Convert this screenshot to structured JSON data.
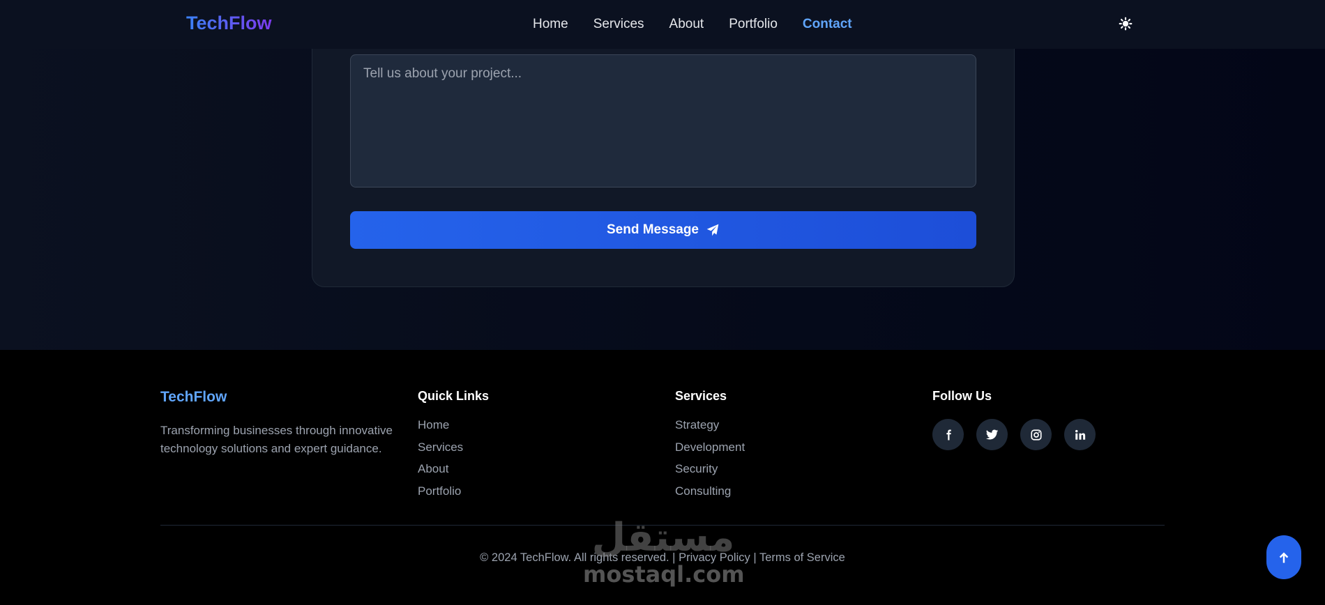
{
  "header": {
    "logo": "TechFlow",
    "nav": [
      {
        "label": "Home",
        "active": false
      },
      {
        "label": "Services",
        "active": false
      },
      {
        "label": "About",
        "active": false
      },
      {
        "label": "Portfolio",
        "active": false
      },
      {
        "label": "Contact",
        "active": true
      }
    ],
    "theme_icon": "sun-icon"
  },
  "form": {
    "message_placeholder": "Tell us about your project...",
    "message_value": "",
    "send_label": "Send Message",
    "send_icon": "paper-plane-icon"
  },
  "footer": {
    "brand": "TechFlow",
    "description": "Transforming businesses through innovative technology solutions and expert guidance.",
    "quick_links": {
      "title": "Quick Links",
      "items": [
        "Home",
        "Services",
        "About",
        "Portfolio"
      ]
    },
    "services": {
      "title": "Services",
      "items": [
        "Strategy",
        "Development",
        "Security",
        "Consulting"
      ]
    },
    "follow": {
      "title": "Follow Us",
      "icons": [
        "facebook-icon",
        "twitter-icon",
        "instagram-icon",
        "linkedin-icon"
      ]
    },
    "copyright": "© 2024 TechFlow. All rights reserved.",
    "separator": "|",
    "privacy": "Privacy Policy",
    "terms": "Terms of Service"
  },
  "watermark": {
    "arabic": "مستقل",
    "latin": "mostaql.com"
  },
  "scroll_top_icon": "arrow-up-icon",
  "colors": {
    "accent": "#2563eb",
    "link_active": "#60a5fa",
    "footer_bg": "#000000",
    "card_bg": "#111827"
  }
}
